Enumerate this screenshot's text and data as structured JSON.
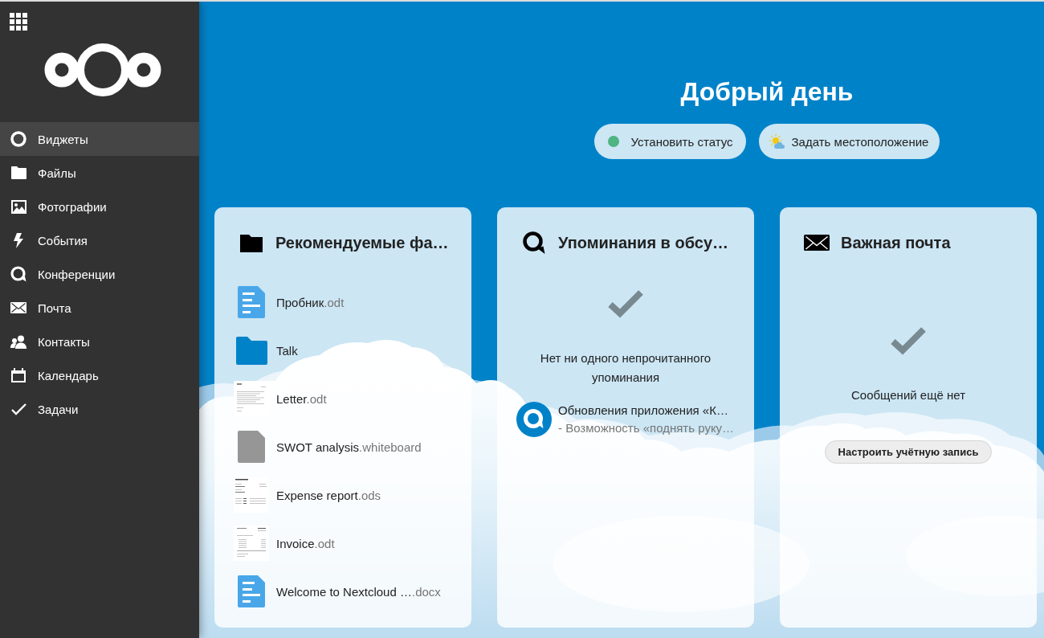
{
  "sidebar": {
    "items": [
      {
        "kind": "widgets",
        "label": "Виджеты",
        "selected": true
      },
      {
        "kind": "files",
        "label": "Файлы",
        "selected": false
      },
      {
        "kind": "photos",
        "label": "Фотографии",
        "selected": false
      },
      {
        "kind": "activity",
        "label": "События",
        "selected": false
      },
      {
        "kind": "talk",
        "label": "Конференции",
        "selected": false
      },
      {
        "kind": "mail",
        "label": "Почта",
        "selected": false
      },
      {
        "kind": "contacts",
        "label": "Контакты",
        "selected": false
      },
      {
        "kind": "calendar",
        "label": "Календарь",
        "selected": false
      },
      {
        "kind": "tasks",
        "label": "Задачи",
        "selected": false
      }
    ]
  },
  "header": {
    "greeting": "Добрый день",
    "actions": [
      {
        "kind": "status",
        "label": "Установить статус",
        "color": "#4db482"
      },
      {
        "kind": "weather",
        "label": "Задать местоположение"
      }
    ]
  },
  "widgets": [
    {
      "kind": "files",
      "title": "Рекомендуемые фа…",
      "items": [
        {
          "kind": "document",
          "name": "Пробник",
          "extension": ".odt"
        },
        {
          "kind": "folder",
          "name": "Talk"
        },
        {
          "kind": "preview",
          "name": "Letter",
          "extension": ".odt"
        },
        {
          "kind": "file",
          "name": "SWOT analysis",
          "extension": ".whiteboard"
        },
        {
          "kind": "preview",
          "name": "Expense report",
          "extension": ".ods"
        },
        {
          "kind": "preview",
          "name": "Invoice",
          "extension": ".odt"
        },
        {
          "kind": "document",
          "name": "Welcome to Nextcloud …",
          "extension": ".docx"
        }
      ]
    },
    {
      "kind": "talk",
      "title": "Упоминания в обсу…",
      "empty_message": "Нет ни одного непрочитанного упоминания",
      "items": [
        {
          "title": "Обновления приложения «К…",
          "subtitle": "- Возможность «поднять руку…"
        }
      ]
    },
    {
      "kind": "mail",
      "title": "Важная почта",
      "empty_message": "Сообщений ещё нет",
      "button": "Настроить учётную запись"
    }
  ]
}
